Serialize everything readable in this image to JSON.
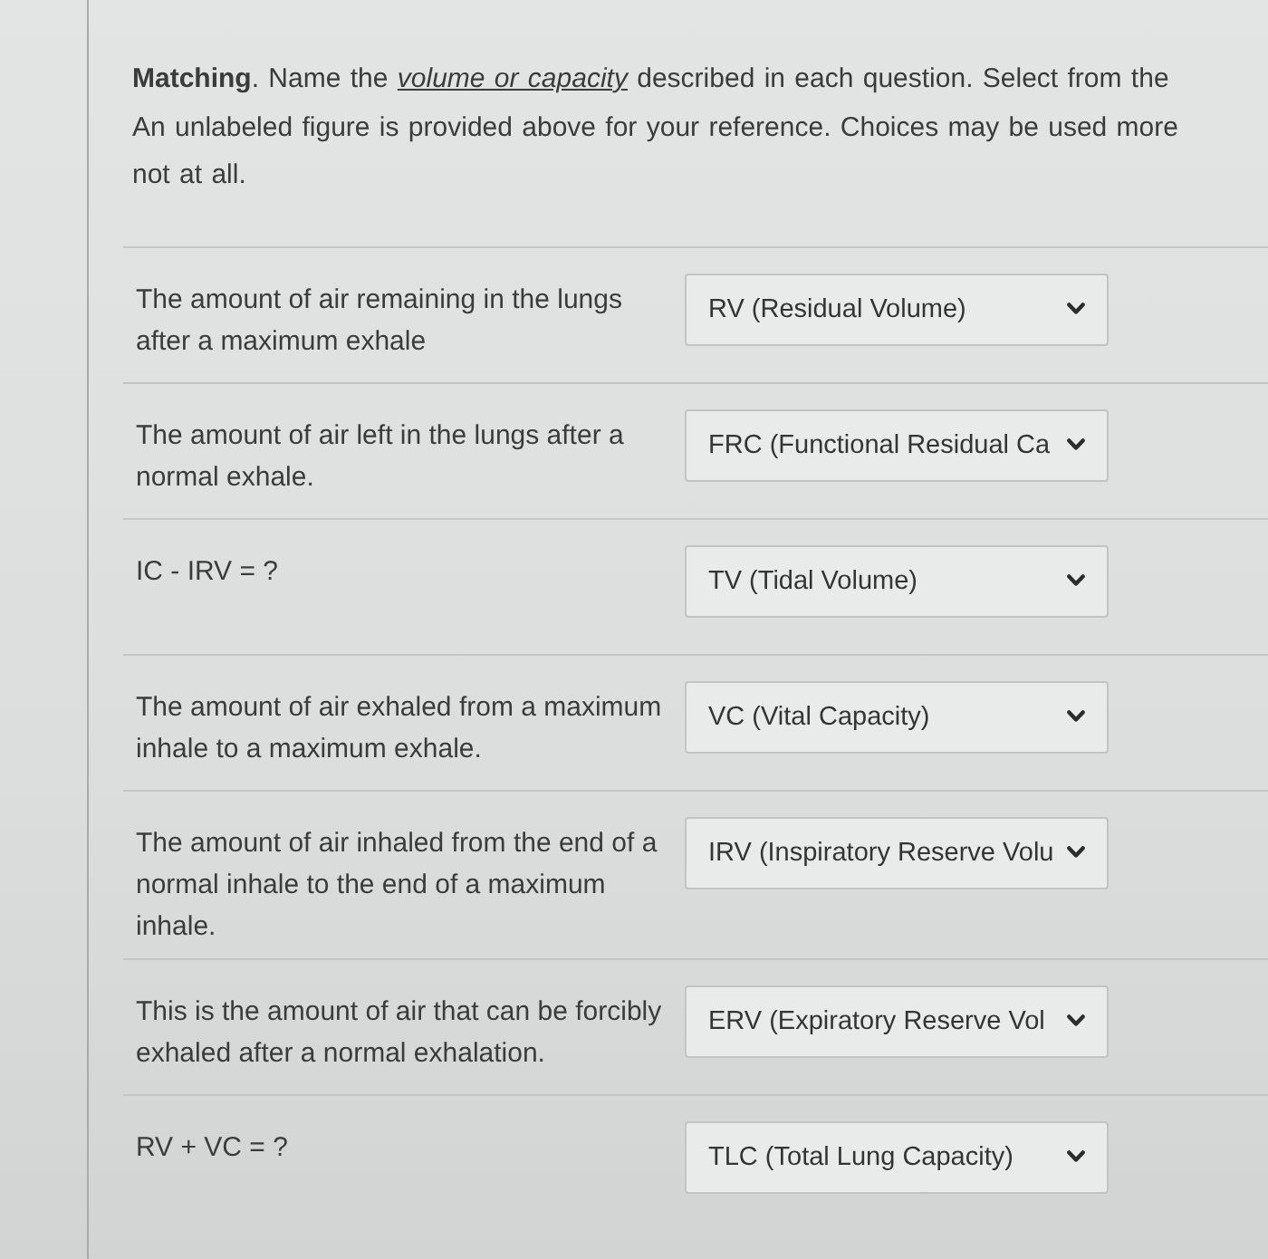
{
  "intro": {
    "lines": [
      "**Matching**. Name the *volume or capacity* described in each question. Select from the",
      "An unlabeled figure is provided above for your reference. Choices may be used more",
      "not at all."
    ]
  },
  "questions": [
    {
      "prompt": "The amount of air remaining in the lungs after a maximum exhale",
      "answer": "RV (Residual Volume)"
    },
    {
      "prompt": "The amount of air left in the lungs after a normal exhale.",
      "answer": "FRC (Functional Residual Ca"
    },
    {
      "prompt": "IC - IRV = ?",
      "answer": "TV (Tidal Volume)"
    },
    {
      "prompt": "The amount of air exhaled from a maximum inhale to a maximum exhale.",
      "answer": "VC (Vital Capacity)"
    },
    {
      "prompt": "The amount of air inhaled from the end of a normal inhale to the end of a maximum inhale.",
      "answer": "IRV (Inspiratory Reserve Volu"
    },
    {
      "prompt": "This is the amount of air that can be forcibly exhaled after a normal exhalation.",
      "answer": "ERV (Expiratory Reserve Vol"
    },
    {
      "prompt": "RV + VC = ?",
      "answer": "TLC (Total Lung Capacity)"
    }
  ]
}
